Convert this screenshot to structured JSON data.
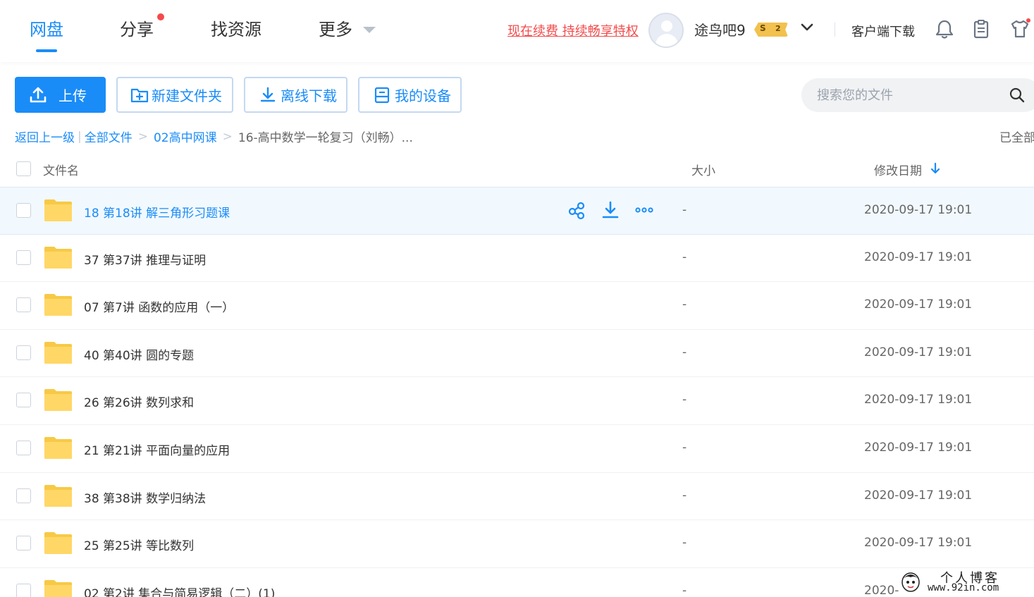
{
  "nav": {
    "tabs": [
      {
        "label": "网盘",
        "active": true
      },
      {
        "label": "分享",
        "has_dot": true
      },
      {
        "label": "找资源"
      },
      {
        "label": "更多"
      }
    ],
    "promo": "现在续费 持续畅享特权",
    "username": "途鸟吧9",
    "vip_level": "2",
    "vip_symbol": "S",
    "client_download": "客户端下载",
    "icons": [
      "bell-icon",
      "clipboard-icon",
      "tshirt-icon"
    ]
  },
  "toolbar": {
    "upload": "上传",
    "new_folder": "新建文件夹",
    "offline_download": "离线下载",
    "my_devices": "我的设备",
    "search_placeholder": "搜索您的文件"
  },
  "breadcrumb": {
    "back": "返回上一级",
    "items": [
      "全部文件",
      "02高中网课"
    ],
    "current": "16-高中数学一轮复习（刘畅）...",
    "loaded_all": "已全部"
  },
  "table": {
    "columns": {
      "name": "文件名",
      "size": "大小",
      "modified": "修改日期"
    },
    "sort": {
      "column": "modified",
      "direction": "desc"
    },
    "rows": [
      {
        "name": "18 第18讲 解三角形习题课",
        "size": "-",
        "date": "2020-09-17 19:01",
        "hover": true
      },
      {
        "name": "37 第37讲 推理与证明",
        "size": "-",
        "date": "2020-09-17 19:01"
      },
      {
        "name": "07 第7讲 函数的应用（一）",
        "size": "-",
        "date": "2020-09-17 19:01"
      },
      {
        "name": "40 第40讲 圆的专题",
        "size": "-",
        "date": "2020-09-17 19:01"
      },
      {
        "name": "26 第26讲 数列求和",
        "size": "-",
        "date": "2020-09-17 19:01"
      },
      {
        "name": "21 第21讲 平面向量的应用",
        "size": "-",
        "date": "2020-09-17 19:01"
      },
      {
        "name": "38 第38讲 数学归纳法",
        "size": "-",
        "date": "2020-09-17 19:01"
      },
      {
        "name": "25 第25讲 等比数列",
        "size": "-",
        "date": "2020-09-17 19:01"
      },
      {
        "name": "02 第2讲 集合与简易逻辑（二）(1)",
        "size": "-",
        "date": "2020-"
      }
    ],
    "row_actions": [
      "share-icon",
      "download-icon",
      "more-icon"
    ]
  },
  "watermark": {
    "title": "个人博客",
    "url": "www.92in.com"
  },
  "colors": {
    "accent": "#1a8cf8",
    "promo": "#f24c4c",
    "folder": "#ffd766",
    "hover_row": "#f1f9fe"
  }
}
